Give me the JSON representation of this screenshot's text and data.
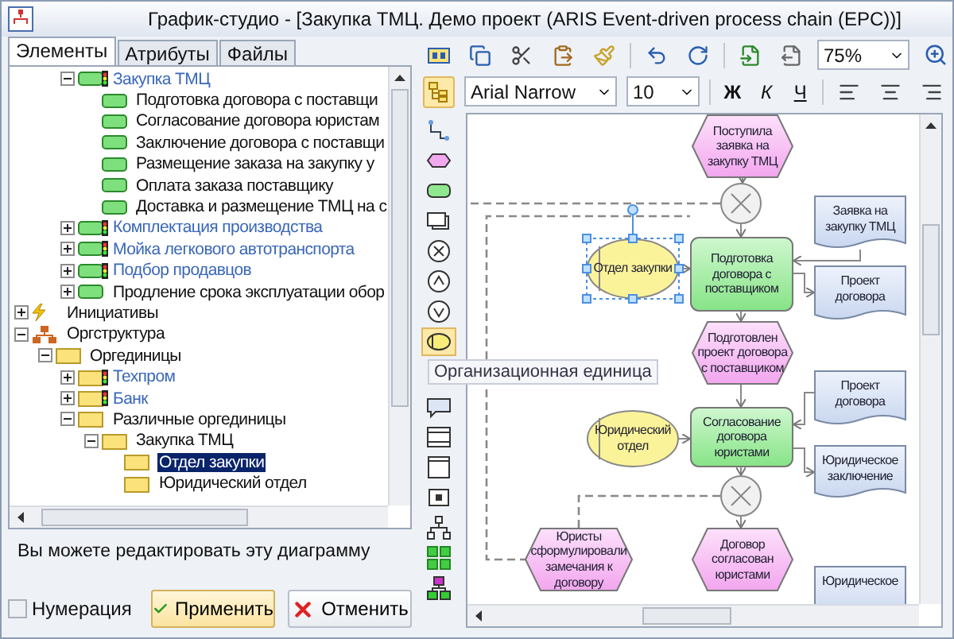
{
  "window": {
    "title": "График-студио - [Закупка ТМЦ. Демо проект (ARIS Event-driven process chain (EPC))]"
  },
  "tabs": [
    {
      "label": "Элементы",
      "selected": true
    },
    {
      "label": "Атрибуты",
      "selected": false
    },
    {
      "label": "Файлы",
      "selected": false
    }
  ],
  "tree": {
    "partial_branch": [
      {
        "label": "Закупка ТМЦ",
        "kind": "process",
        "linked": true,
        "expanded": true,
        "selected": false,
        "children": [
          {
            "label": "Подготовка договора с поставщи",
            "kind": "function",
            "linked": false,
            "selected": false
          },
          {
            "label": "Согласование договора юристам",
            "kind": "function",
            "linked": false,
            "selected": false
          },
          {
            "label": "Заключение договора с поставщи",
            "kind": "function",
            "linked": false,
            "selected": false
          },
          {
            "label": "Размещение заказа на закупку у",
            "kind": "function",
            "linked": false,
            "selected": false
          },
          {
            "label": "Оплата заказа поставщику",
            "kind": "function",
            "linked": false,
            "selected": false
          },
          {
            "label": "Доставка и размещение ТМЦ на с",
            "kind": "function",
            "linked": false,
            "selected": false
          }
        ]
      },
      {
        "label": "Комплектация производства",
        "kind": "process",
        "linked": true,
        "expanded": false,
        "selected": false
      },
      {
        "label": "Мойка легкового автотранспорта",
        "kind": "process",
        "linked": true,
        "expanded": false,
        "selected": false
      },
      {
        "label": "Подбор продавцов",
        "kind": "process",
        "linked": true,
        "expanded": false,
        "selected": false
      },
      {
        "label": "Продление срока эксплуатации обор",
        "kind": "function",
        "linked": false,
        "expanded": false,
        "selected": false
      }
    ],
    "items": [
      {
        "label": "Инициативы",
        "kind": "initiatives",
        "linked": false,
        "expanded": false,
        "selected": false
      },
      {
        "label": "Оргструктура",
        "kind": "orgchart",
        "linked": false,
        "expanded": true,
        "selected": false,
        "children": [
          {
            "label": "Оргединицы",
            "kind": "folder",
            "linked": false,
            "expanded": true,
            "selected": false,
            "children": [
              {
                "label": "Техпром",
                "kind": "folder-process",
                "linked": true,
                "expanded": false,
                "selected": false
              },
              {
                "label": "Банк",
                "kind": "folder-process",
                "linked": true,
                "expanded": false,
                "selected": false
              },
              {
                "label": "Различные оргединицы",
                "kind": "folder",
                "linked": false,
                "expanded": true,
                "selected": false,
                "children": [
                  {
                    "label": "Закупка ТМЦ",
                    "kind": "folder",
                    "linked": false,
                    "expanded": true,
                    "selected": false,
                    "children": [
                      {
                        "label": "Отдел закупки",
                        "kind": "folder",
                        "linked": false,
                        "selected": true
                      },
                      {
                        "label": "Юридический отдел",
                        "kind": "folder",
                        "linked": false,
                        "selected": false
                      }
                    ]
                  }
                ]
              }
            ]
          }
        ]
      }
    ]
  },
  "status_text": "Вы можете редактировать эту диаграмму",
  "numbering": {
    "label": "Нумерация",
    "checked": false
  },
  "buttons": [
    {
      "label": "Применить",
      "kind": "apply"
    },
    {
      "label": "Отменить",
      "kind": "cancel"
    }
  ],
  "toolbar": {
    "zoom": "75%"
  },
  "format_bar": {
    "tree_toggle_pressed": true,
    "font": "Arial Narrow",
    "size": "10",
    "styles": [
      "Ж",
      "К",
      "Ч"
    ]
  },
  "tools": [
    {
      "kind": "connector",
      "selected": false
    },
    {
      "kind": "event",
      "selected": false
    },
    {
      "kind": "function",
      "selected": false
    },
    {
      "kind": "document",
      "selected": false
    },
    {
      "kind": "xor",
      "selected": false
    },
    {
      "kind": "and",
      "selected": false
    },
    {
      "kind": "or",
      "selected": false
    },
    {
      "kind": "orgunit",
      "selected": true
    },
    {
      "kind": "comment",
      "selected": false
    },
    {
      "kind": "window",
      "selected": false
    },
    {
      "kind": "frame",
      "selected": false
    },
    {
      "kind": "parameter",
      "selected": false
    },
    {
      "kind": "hierarchy",
      "selected": false
    },
    {
      "kind": "grid",
      "selected": false
    },
    {
      "kind": "green-hierarchy",
      "selected": false
    }
  ],
  "tooltip": "Организационная единица",
  "diagram": {
    "nodes": [
      {
        "kind": "event",
        "text": "Поступила заявка на закупку ТМЦ",
        "selected": false
      },
      {
        "kind": "xor",
        "selected": false
      },
      {
        "kind": "document",
        "text": "Заявка на закупку ТМЦ",
        "selected": false
      },
      {
        "kind": "org",
        "text": "Отдел закупки",
        "selected": true
      },
      {
        "kind": "function",
        "text": "Подготовка договора с поставщиком",
        "selected": false
      },
      {
        "kind": "document",
        "text": "Проект договора",
        "selected": false
      },
      {
        "kind": "event",
        "text": "Подготовлен проект договора с поставщиком",
        "selected": false
      },
      {
        "kind": "document",
        "text": "Проект договора",
        "selected": false
      },
      {
        "kind": "org",
        "text": "Юридический отдел",
        "selected": false
      },
      {
        "kind": "function",
        "text": "Согласование договора юристами",
        "selected": false
      },
      {
        "kind": "document",
        "text": "Юридическое заключение",
        "selected": false
      },
      {
        "kind": "xor",
        "selected": false
      },
      {
        "kind": "event",
        "text": "Юристы сформулировали замечания к договору",
        "selected": false
      },
      {
        "kind": "event",
        "text": "Договор согласован юристами",
        "selected": false
      },
      {
        "kind": "document",
        "text": "Юридическое",
        "selected": false
      }
    ]
  }
}
